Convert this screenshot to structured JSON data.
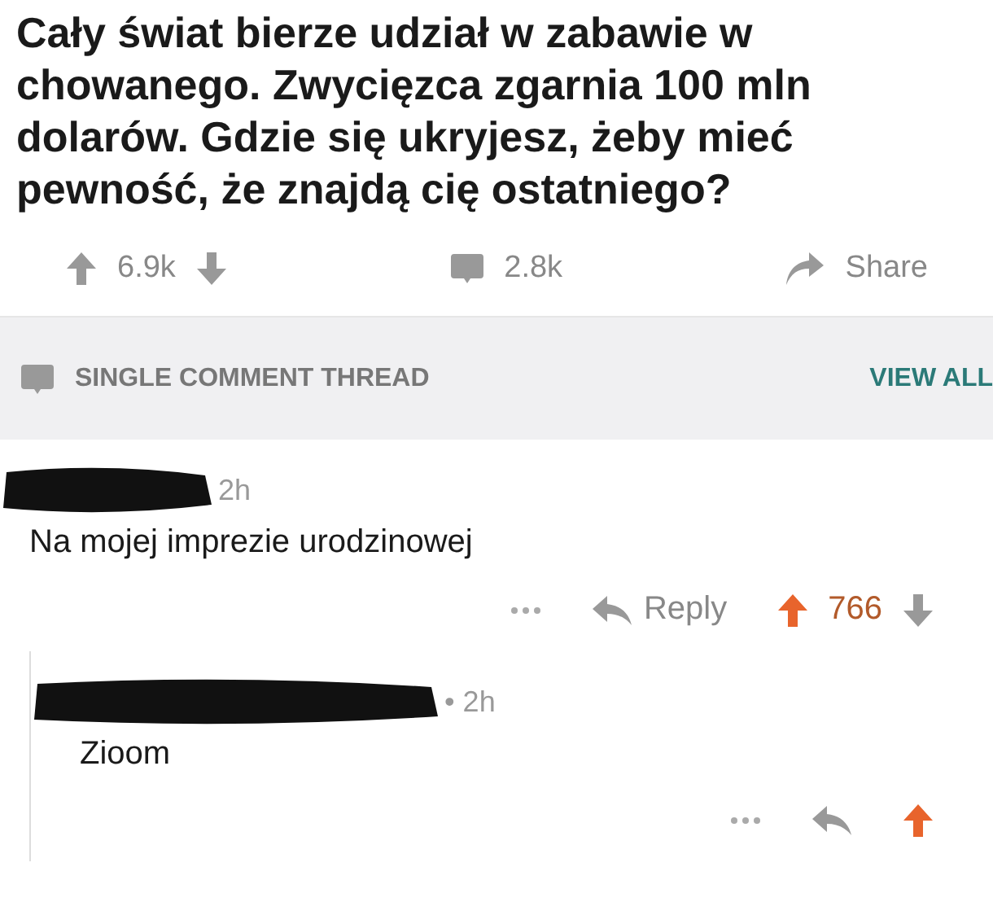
{
  "post": {
    "title": "Cały świat bierze udział w zabawie w chowanego. Zwycięzca zgarnia 100 mln dolarów. Gdzie się ukryjesz, żeby mieć pewność, że znajdą cię ostatniego?",
    "upvotes": "6.9k",
    "comments": "2.8k",
    "share": "Share"
  },
  "thread_bar": {
    "label": "SINGLE COMMENT THREAD",
    "link": "VIEW ALL"
  },
  "comments": [
    {
      "time": "2h",
      "text": "Na mojej imprezie urodzinowej",
      "reply": "Reply",
      "score": "766",
      "upvoted": true,
      "children": [
        {
          "time": "• 2h",
          "text": "Zioom",
          "upvoted": true
        }
      ]
    }
  ]
}
